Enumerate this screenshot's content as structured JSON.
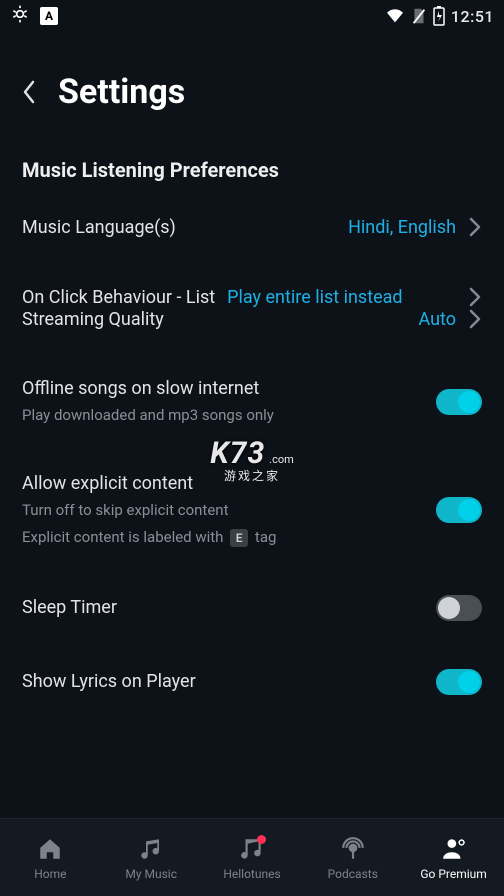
{
  "status": {
    "clock": "12:51"
  },
  "header": {
    "title": "Settings"
  },
  "section": {
    "label": "Music Listening Preferences"
  },
  "rows": {
    "music_language": {
      "label": "Music Language(s)",
      "value": "Hindi, English"
    },
    "on_click": {
      "label": "On Click Behaviour - List",
      "value": "Play entire list instead"
    },
    "streaming_quality": {
      "label": "Streaming Quality",
      "value": "Auto"
    },
    "offline": {
      "label": "Offline songs on slow internet",
      "sub": "Play downloaded and mp3 songs only",
      "on": true
    },
    "explicit": {
      "label": "Allow explicit content",
      "sub1": "Turn off to skip explicit content",
      "sub2a": "Explicit content is labeled with",
      "sub2b": "E",
      "sub2c": "tag",
      "on": true
    },
    "sleep": {
      "label": "Sleep Timer",
      "on": false
    },
    "lyrics": {
      "label": "Show Lyrics on Player",
      "on": true
    }
  },
  "watermark": {
    "main": "K73",
    "sub": "游戏之家",
    "dom": ".com"
  },
  "nav": {
    "home": "Home",
    "my_music": "My Music",
    "hellotunes": "Hellotunes",
    "podcasts": "Podcasts",
    "premium": "Go Premium"
  }
}
